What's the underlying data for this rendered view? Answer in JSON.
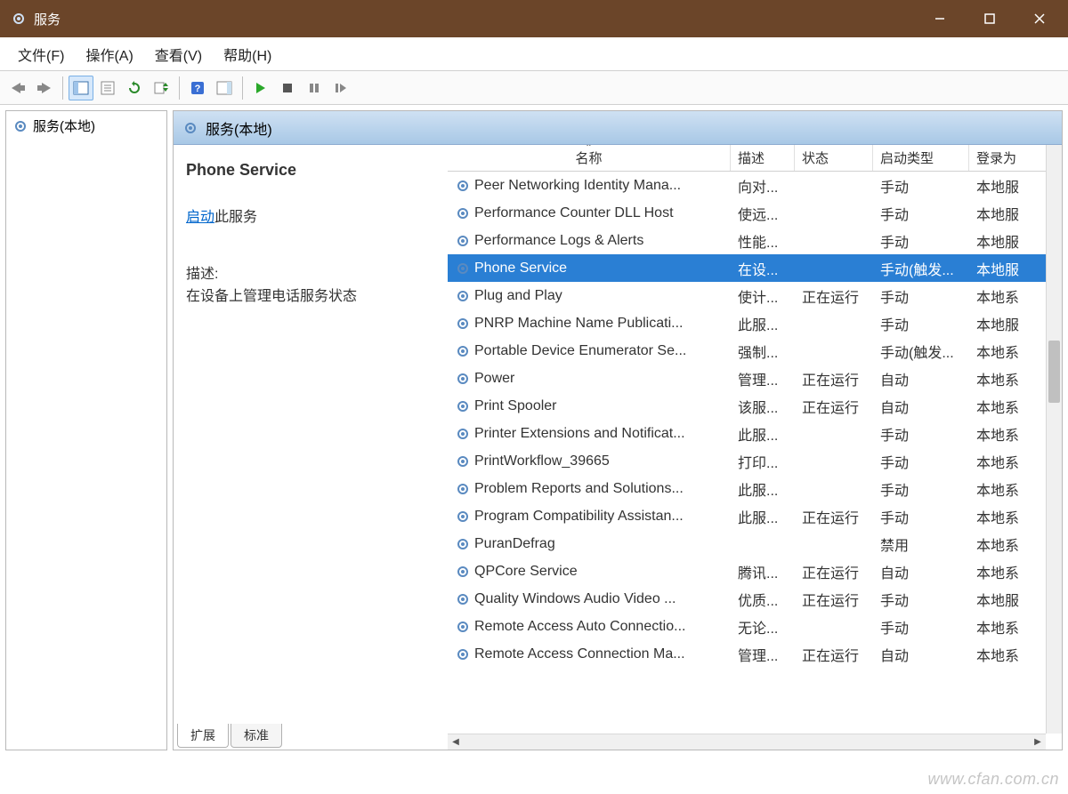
{
  "window": {
    "title": "服务"
  },
  "menu": {
    "file": "文件(F)",
    "action": "操作(A)",
    "view": "查看(V)",
    "help": "帮助(H)"
  },
  "left_tree": {
    "root": "服务(本地)"
  },
  "right_header": {
    "label": "服务(本地)"
  },
  "detail": {
    "title": "Phone Service",
    "start_link": "启动",
    "start_suffix": "此服务",
    "desc_label": "描述:",
    "desc_text": "在设备上管理电话服务状态"
  },
  "columns": {
    "name": "名称",
    "desc": "描述",
    "status": "状态",
    "startup": "启动类型",
    "logon": "登录为"
  },
  "rows": [
    {
      "name": "Peer Networking Identity Mana...",
      "desc": "向对...",
      "status": "",
      "startup": "手动",
      "logon": "本地服"
    },
    {
      "name": "Performance Counter DLL Host",
      "desc": "使远...",
      "status": "",
      "startup": "手动",
      "logon": "本地服"
    },
    {
      "name": "Performance Logs & Alerts",
      "desc": "性能...",
      "status": "",
      "startup": "手动",
      "logon": "本地服"
    },
    {
      "name": "Phone Service",
      "desc": "在设...",
      "status": "",
      "startup": "手动(触发...",
      "logon": "本地服",
      "selected": true
    },
    {
      "name": "Plug and Play",
      "desc": "使计...",
      "status": "正在运行",
      "startup": "手动",
      "logon": "本地系"
    },
    {
      "name": "PNRP Machine Name Publicati...",
      "desc": "此服...",
      "status": "",
      "startup": "手动",
      "logon": "本地服"
    },
    {
      "name": "Portable Device Enumerator Se...",
      "desc": "强制...",
      "status": "",
      "startup": "手动(触发...",
      "logon": "本地系"
    },
    {
      "name": "Power",
      "desc": "管理...",
      "status": "正在运行",
      "startup": "自动",
      "logon": "本地系"
    },
    {
      "name": "Print Spooler",
      "desc": "该服...",
      "status": "正在运行",
      "startup": "自动",
      "logon": "本地系"
    },
    {
      "name": "Printer Extensions and Notificat...",
      "desc": "此服...",
      "status": "",
      "startup": "手动",
      "logon": "本地系"
    },
    {
      "name": "PrintWorkflow_39665",
      "desc": "打印...",
      "status": "",
      "startup": "手动",
      "logon": "本地系"
    },
    {
      "name": "Problem Reports and Solutions...",
      "desc": "此服...",
      "status": "",
      "startup": "手动",
      "logon": "本地系"
    },
    {
      "name": "Program Compatibility Assistan...",
      "desc": "此服...",
      "status": "正在运行",
      "startup": "手动",
      "logon": "本地系"
    },
    {
      "name": "PuranDefrag",
      "desc": "",
      "status": "",
      "startup": "禁用",
      "logon": "本地系"
    },
    {
      "name": "QPCore Service",
      "desc": "腾讯...",
      "status": "正在运行",
      "startup": "自动",
      "logon": "本地系"
    },
    {
      "name": "Quality Windows Audio Video ...",
      "desc": "优质...",
      "status": "正在运行",
      "startup": "手动",
      "logon": "本地服"
    },
    {
      "name": "Remote Access Auto Connectio...",
      "desc": "无论...",
      "status": "",
      "startup": "手动",
      "logon": "本地系"
    },
    {
      "name": "Remote Access Connection Ma...",
      "desc": "管理...",
      "status": "正在运行",
      "startup": "自动",
      "logon": "本地系"
    }
  ],
  "tabs": {
    "extended": "扩展",
    "standard": "标准"
  },
  "watermark": "www.cfan.com.cn"
}
